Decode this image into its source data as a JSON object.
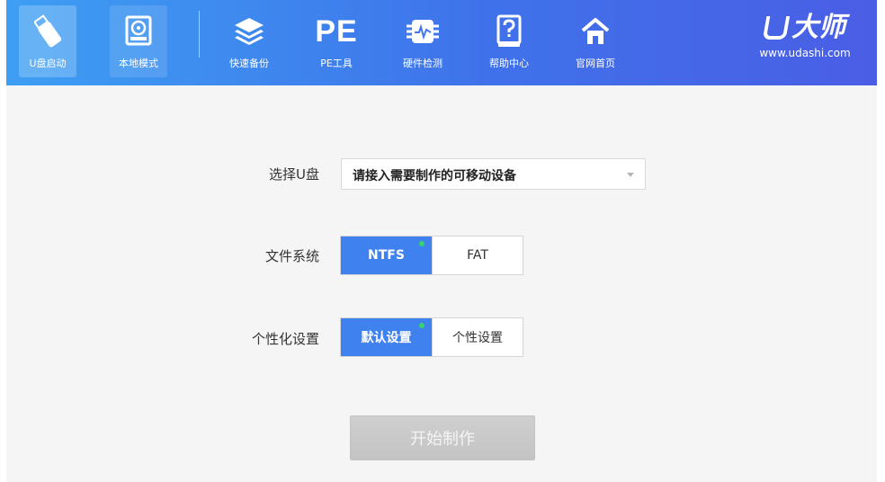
{
  "nav": {
    "items": [
      {
        "label": "U盘启动",
        "icon": "usb-drive-icon"
      },
      {
        "label": "本地模式",
        "icon": "hard-disk-icon"
      },
      {
        "label": "快速备份",
        "icon": "layers-icon"
      },
      {
        "label": "PE工具",
        "icon": "pe-icon",
        "icon_text": "PE"
      },
      {
        "label": "硬件检测",
        "icon": "chip-icon"
      },
      {
        "label": "帮助中心",
        "icon": "help-icon"
      },
      {
        "label": "官网首页",
        "icon": "home-icon"
      }
    ],
    "active_index": 0
  },
  "brand": {
    "name": "大师",
    "url": "www.udashi.com"
  },
  "form": {
    "select_usb": {
      "label": "选择U盘",
      "value": "请接入需要制作的可移动设备"
    },
    "file_system": {
      "label": "文件系统",
      "options": [
        "NTFS",
        "FAT"
      ],
      "selected": "NTFS"
    },
    "personalization": {
      "label": "个性化设置",
      "options": [
        "默认设置",
        "个性设置"
      ],
      "selected": "默认设置"
    },
    "start_button": "开始制作"
  },
  "colors": {
    "accent": "#3f82ef",
    "indicator": "#37d36b",
    "button_disabled": "#c8c8c8"
  }
}
